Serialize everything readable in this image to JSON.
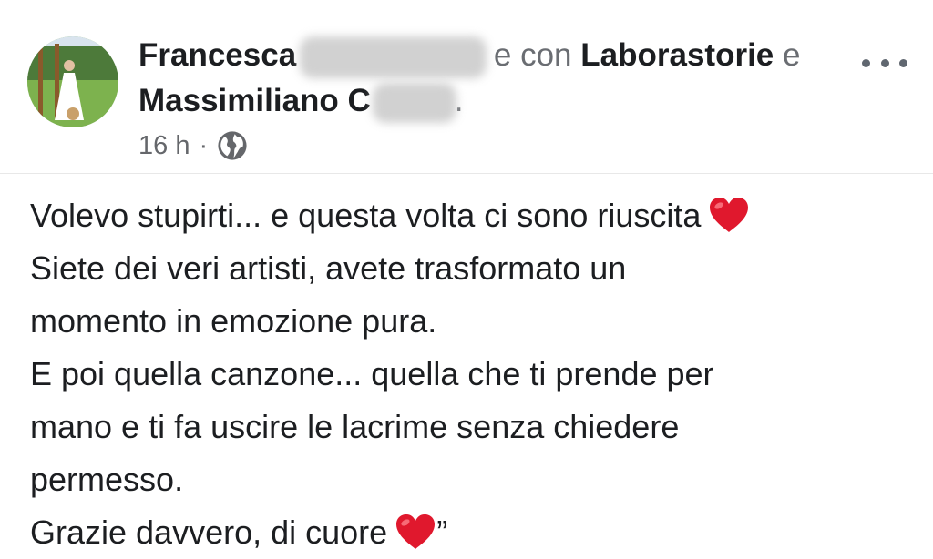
{
  "post": {
    "author": {
      "name_first": "Francesca",
      "connector": "e con",
      "tagged_page": "Laborastorie",
      "conjunction": "e",
      "tagged_person": "Massimiliano C",
      "trailing": "."
    },
    "meta": {
      "time": "16 h",
      "separator": "·",
      "audience_icon": "globe-icon"
    },
    "more_icon": "more-options-icon",
    "body": {
      "line1": "Volevo stupirti... e questa volta ci sono riuscita",
      "line2": "Siete dei veri artisti, avete trasformato un",
      "line3": "momento in emozione pura.",
      "line4": "E poi quella canzone... quella che ti prende per",
      "line5": "mano e ti fa uscire le lacrime senza chiedere",
      "line6": "permesso.",
      "line7": "Grazie davvero, di cuore",
      "line7_end": "”"
    },
    "colors": {
      "heart": "#e0182d",
      "text": "#1c1e21",
      "muted": "#65676b"
    }
  }
}
